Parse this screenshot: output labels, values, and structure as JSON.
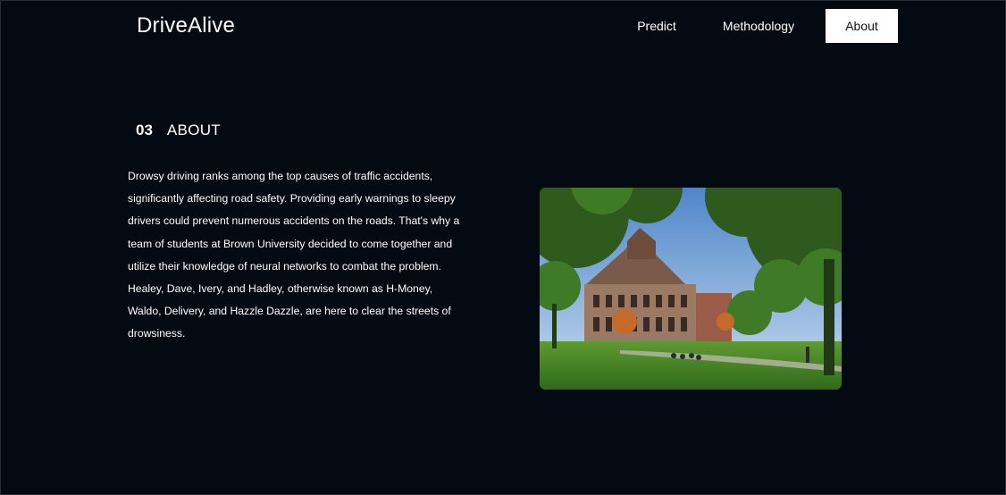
{
  "header": {
    "brand": "DriveAlive",
    "nav": [
      {
        "label": "Predict"
      },
      {
        "label": "Methodology"
      },
      {
        "label": "About",
        "active": true
      }
    ]
  },
  "about": {
    "number": "03",
    "title": "ABOUT",
    "body": "Drowsy driving ranks among the top causes of traffic accidents, significantly affecting road safety. Providing early warnings to sleepy drivers could prevent numerous accidents on the roads. That's why a team of students at Brown University decided to come together and utilize their knowledge of neural networks to combat the problem. Healey, Dave, Ivery, and Hadley, otherwise known as H-Money, Waldo, Delivery, and Hazzle Dazzle, are here to clear the streets of drowsiness.",
    "photo": "campus-building-photo"
  },
  "colors": {
    "background": "#040a11",
    "text": "#ffffff",
    "active_nav_bg": "#ffffff",
    "active_nav_text": "#111111"
  }
}
